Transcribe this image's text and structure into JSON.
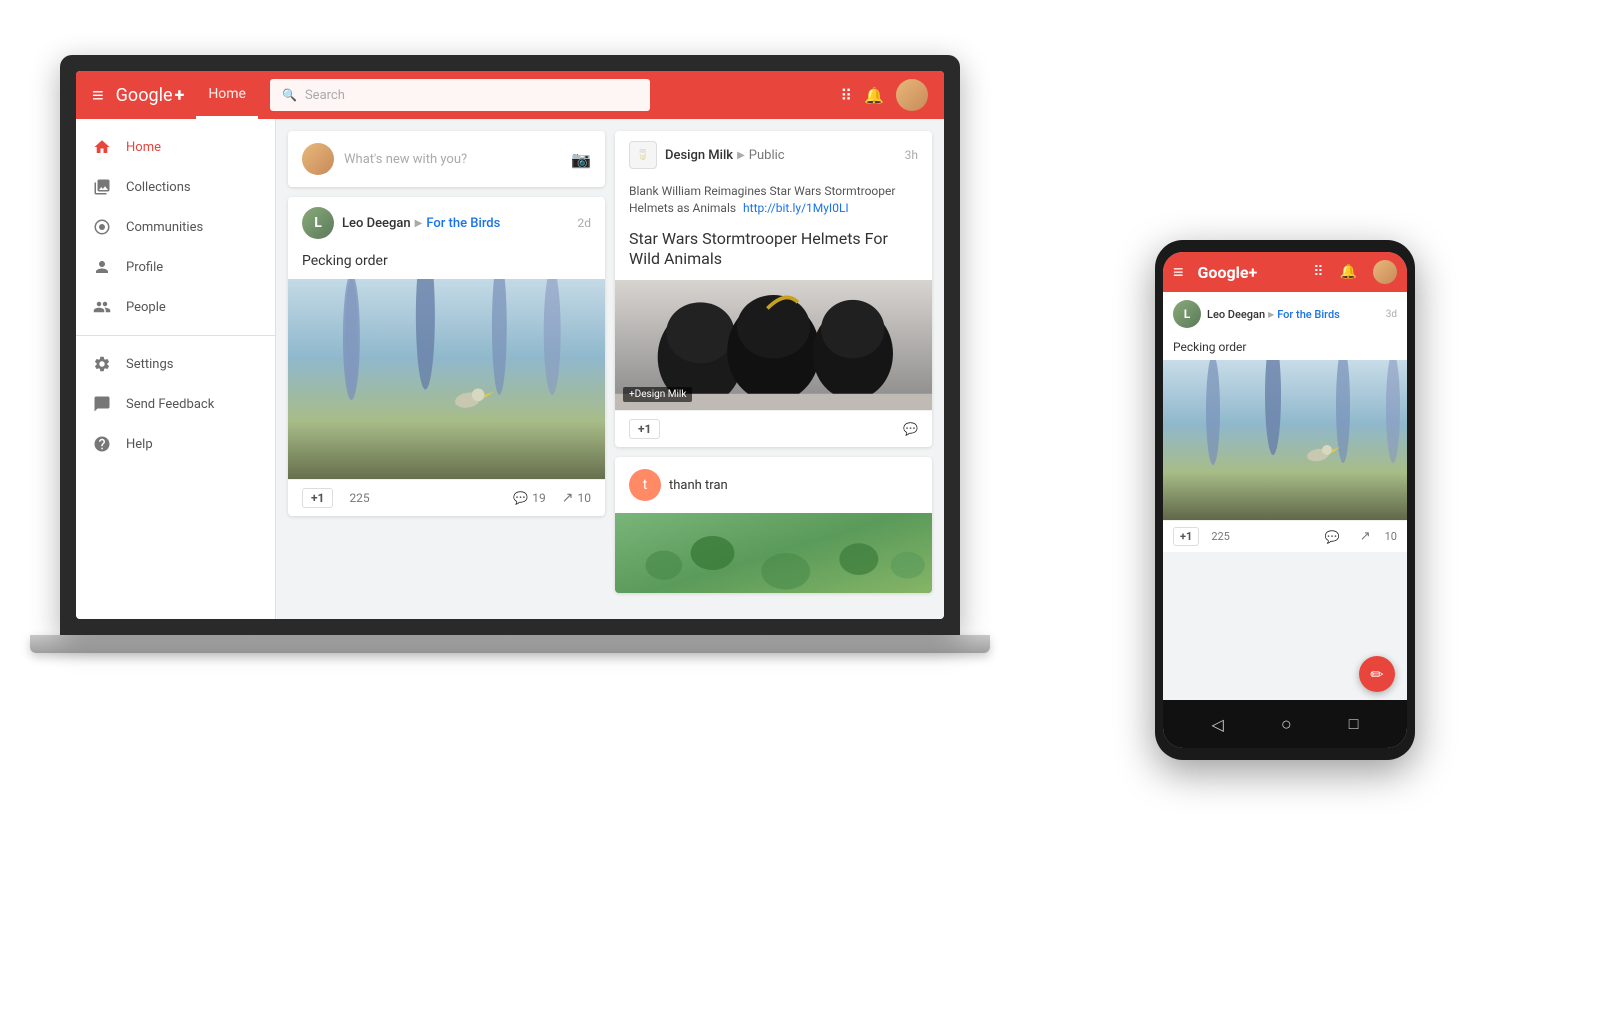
{
  "app": {
    "name": "Google+",
    "name_superscript": "+",
    "page_title": "Home"
  },
  "header": {
    "menu_icon": "hamburger",
    "logo": "Google+",
    "nav_tab": "Home",
    "search_placeholder": "Search",
    "apps_icon": "apps",
    "bell_icon": "notifications",
    "avatar_alt": "user avatar"
  },
  "sidebar": {
    "items": [
      {
        "id": "home",
        "label": "Home",
        "icon": "home",
        "active": true
      },
      {
        "id": "collections",
        "label": "Collections",
        "icon": "collections",
        "active": false
      },
      {
        "id": "communities",
        "label": "Communities",
        "icon": "communities",
        "active": false
      },
      {
        "id": "profile",
        "label": "Profile",
        "icon": "profile",
        "active": false
      },
      {
        "id": "people",
        "label": "People",
        "icon": "people",
        "active": false
      }
    ],
    "secondary_items": [
      {
        "id": "settings",
        "label": "Settings",
        "icon": "settings"
      },
      {
        "id": "feedback",
        "label": "Send Feedback",
        "icon": "feedback"
      },
      {
        "id": "help",
        "label": "Help",
        "icon": "help"
      }
    ]
  },
  "compose": {
    "placeholder": "What's new with you?"
  },
  "posts": {
    "post1": {
      "author": "Leo Deegan",
      "community": "For the Birds",
      "time": "2d",
      "title": "Pecking order",
      "plusone_count": "225",
      "comment_count": "19",
      "share_count": "10"
    },
    "post2": {
      "source": "Design Milk",
      "visibility": "Public",
      "time": "3h",
      "text": "Blank William Reimagines Star Wars Stormtrooper Helmets as Animals",
      "link": "http://bit.ly/1MyI0LI",
      "headline": "Star Wars Stormtrooper Helmets For Wild Animals",
      "badge": "+Design Milk"
    },
    "post3": {
      "author": "thanh tran"
    }
  },
  "phone": {
    "header": {
      "logo": "Google+",
      "menu_icon": "hamburger"
    },
    "post": {
      "author": "Leo Deegan",
      "community": "For the Birds",
      "time": "3d",
      "title": "Pecking order",
      "plusone_count": "225",
      "comment_count": "",
      "share_count": "10"
    }
  },
  "nav_bottom": {
    "back": "◁",
    "home": "○",
    "recent": "□"
  }
}
